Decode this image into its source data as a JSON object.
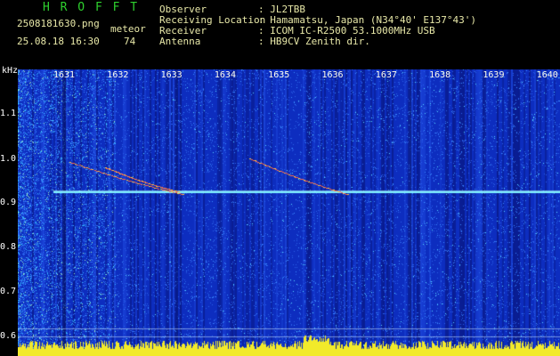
{
  "header": {
    "app_title": "H R O F F T",
    "filename": "2508181630.png",
    "datetime": "25.08.18 16:30",
    "meteor_label": "meteor",
    "meteor_count": "74",
    "fields": [
      {
        "label": "Observer",
        "value": ": JL2TBB"
      },
      {
        "label": "Receiving Location",
        "value": ": Hamamatsu, Japan (N34°40' E137°43')"
      },
      {
        "label": "Receiver",
        "value": ": ICOM IC-R2500 53.1000MHz USB"
      },
      {
        "label": "Antenna",
        "value": ": HB9CV Zenith dir."
      }
    ]
  },
  "spectrogram": {
    "y_unit": "kHz",
    "y_ticks": [
      "1.1",
      "1.0",
      "0.9",
      "0.8",
      "0.7",
      "0.6"
    ],
    "x_ticks": [
      "1631",
      "1632",
      "1633",
      "1634",
      "1635",
      "1636",
      "1637",
      "1638",
      "1639",
      "1640"
    ],
    "colors": {
      "background": "#1133c8",
      "noise": "#3a7bff",
      "trace": "#ffdd44",
      "line": "#66f0ff"
    }
  }
}
